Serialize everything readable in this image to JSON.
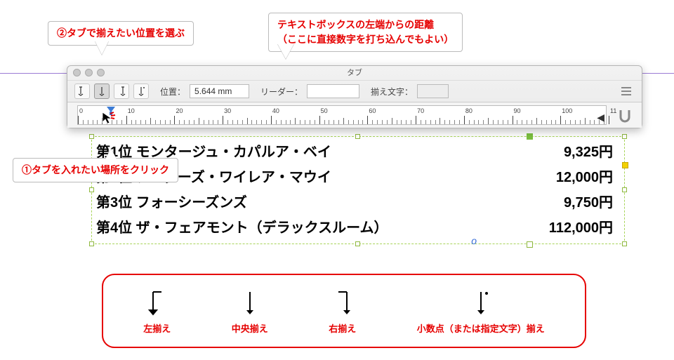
{
  "callouts": {
    "c1": "①タブを入れたい場所をクリック",
    "c2": "②タブで揃えたい位置を選ぶ",
    "c3_line1": "テキストボックスの左端からの距離",
    "c3_line2": "（ここに直接数字を打ち込んでもよい）"
  },
  "panel": {
    "title": "タブ",
    "position_label": "位置：",
    "position_value": "5.644 mm",
    "leader_label": "リーダー：",
    "leader_value": "",
    "alignchar_label": "揃え文字：",
    "alignchar_value": ""
  },
  "ruler": {
    "start": 0,
    "end": 110,
    "major_step": 10,
    "labels": [
      "0",
      "10",
      "20",
      "30",
      "40",
      "50",
      "60",
      "70",
      "80",
      "90",
      "100",
      "11"
    ]
  },
  "textframe": {
    "rows": [
      {
        "left": "第1位 モンタージュ・カパルア・ベイ",
        "right": "9,325円"
      },
      {
        "left": "第2位 アンダーズ・ワイレア・マウイ",
        "right": "12,000円"
      },
      {
        "left": "第3位 フォーシーズンズ",
        "right": "9,750円"
      },
      {
        "left": "第4位 ザ・フェアモント（デラックスルーム）",
        "right": "112,000円"
      }
    ],
    "origin_glyph": "o"
  },
  "legend": {
    "items": [
      {
        "kind": "left",
        "label": "左揃え"
      },
      {
        "kind": "center",
        "label": "中央揃え"
      },
      {
        "kind": "right",
        "label": "右揃え"
      },
      {
        "kind": "decimal",
        "label": "小数点（または指定文字）揃え"
      }
    ]
  }
}
